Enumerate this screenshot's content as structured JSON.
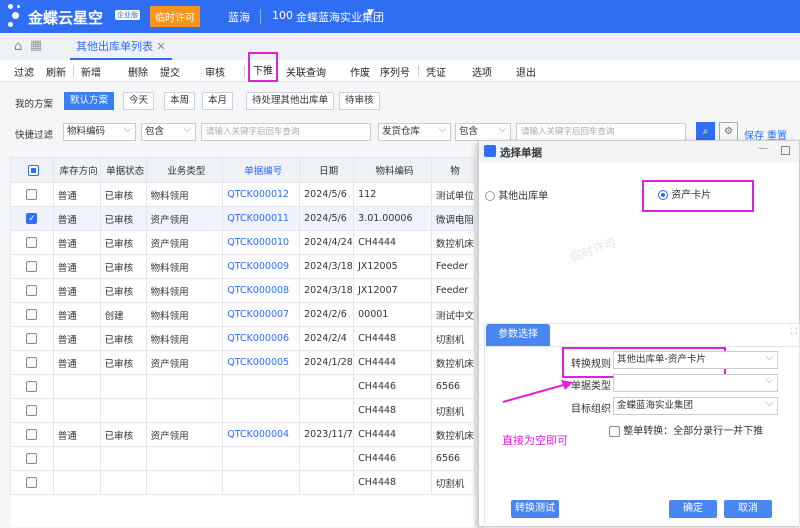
{
  "header": {
    "logo": "金蝶云星空",
    "edition": "企业版",
    "license_badge": "临时许可",
    "user": "蓝海",
    "org_code": "100",
    "org_name": "金蝶蓝海实业集团"
  },
  "tabs": [
    {
      "label": "其他出库单列表"
    }
  ],
  "toolbar": [
    "过滤",
    "刷新",
    "新增",
    "删除",
    "提交",
    "审核",
    "下推",
    "关联查询",
    "作废",
    "序列号",
    "凭证",
    "选项",
    "退出"
  ],
  "schemes": {
    "label": "我的方案",
    "items": [
      "默认方案",
      "今天",
      "本周",
      "本月",
      "待处理其他出库单",
      "待审核"
    ],
    "active": 0
  },
  "quick_filter": {
    "label": "快捷过滤",
    "field1": "物料编码",
    "op1": "包含",
    "placeholder": "请输入关键字后回车查询",
    "field2": "发货仓库",
    "op2": "包含",
    "save": "保存",
    "reset": "重置"
  },
  "table": {
    "columns": [
      "库存方向",
      "单据状态",
      "业务类型",
      "单据编号",
      "日期",
      "物料编码",
      "物"
    ],
    "rows": [
      {
        "checked": false,
        "dir": "普通",
        "status": "已审核",
        "type": "物料领用",
        "no": "QTCK000012",
        "date": "2024/5/6",
        "mat": "112",
        "name": "测试单位"
      },
      {
        "checked": true,
        "dir": "普通",
        "status": "已审核",
        "type": "资产领用",
        "no": "QTCK000011",
        "date": "2024/5/6",
        "mat": "3.01.00006",
        "name": "微调电阻"
      },
      {
        "checked": false,
        "dir": "普通",
        "status": "已审核",
        "type": "资产领用",
        "no": "QTCK000010",
        "date": "2024/4/24",
        "mat": "CH4444",
        "name": "数控机床"
      },
      {
        "checked": false,
        "dir": "普通",
        "status": "已审核",
        "type": "物料领用",
        "no": "QTCK000009",
        "date": "2024/3/18",
        "mat": "JX12005",
        "name": "Feeder"
      },
      {
        "checked": false,
        "dir": "普通",
        "status": "已审核",
        "type": "物料领用",
        "no": "QTCK000008",
        "date": "2024/3/18",
        "mat": "JX12007",
        "name": "Feeder"
      },
      {
        "checked": false,
        "dir": "普通",
        "status": "创建",
        "type": "物料领用",
        "no": "QTCK000007",
        "date": "2024/2/6",
        "mat": "00001",
        "name": "测试中文"
      },
      {
        "checked": false,
        "dir": "普通",
        "status": "已审核",
        "type": "物料领用",
        "no": "QTCK000006",
        "date": "2024/2/4",
        "mat": "CH4448",
        "name": "切割机"
      },
      {
        "checked": false,
        "dir": "普通",
        "status": "已审核",
        "type": "资产领用",
        "no": "QTCK000005",
        "date": "2024/1/28",
        "mat": "CH4444",
        "name": "数控机床"
      },
      {
        "checked": false,
        "dir": "",
        "status": "",
        "type": "",
        "no": "",
        "date": "",
        "mat": "CH4446",
        "name": "6566"
      },
      {
        "checked": false,
        "dir": "",
        "status": "",
        "type": "",
        "no": "",
        "date": "",
        "mat": "CH4448",
        "name": "切割机"
      },
      {
        "checked": false,
        "dir": "普通",
        "status": "已审核",
        "type": "资产领用",
        "no": "QTCK000004",
        "date": "2023/11/7",
        "mat": "CH4444",
        "name": "数控机床"
      },
      {
        "checked": false,
        "dir": "",
        "status": "",
        "type": "",
        "no": "",
        "date": "",
        "mat": "CH4446",
        "name": "6566"
      },
      {
        "checked": false,
        "dir": "",
        "status": "",
        "type": "",
        "no": "",
        "date": "",
        "mat": "CH4448",
        "name": "切割机"
      }
    ]
  },
  "dialog": {
    "title": "选择单据",
    "option1": "其他出库单",
    "option2": "资产卡片",
    "selected": "资产卡片",
    "param_tab": "参数选择",
    "rule_label": "转换规则",
    "rule_value": "其他出库单-资产卡片",
    "type_label": "单据类型",
    "type_value": "",
    "org_label": "目标组织",
    "org_value": "金蝶蓝海实业集团",
    "whole_label": "整单转换：全部分录行一并下推",
    "test_btn": "转换测试",
    "ok_btn": "确定",
    "cancel_btn": "取消"
  },
  "annotation": {
    "text": "直接为空即可",
    "color": "#e020e0"
  },
  "watermark": "临时许可"
}
